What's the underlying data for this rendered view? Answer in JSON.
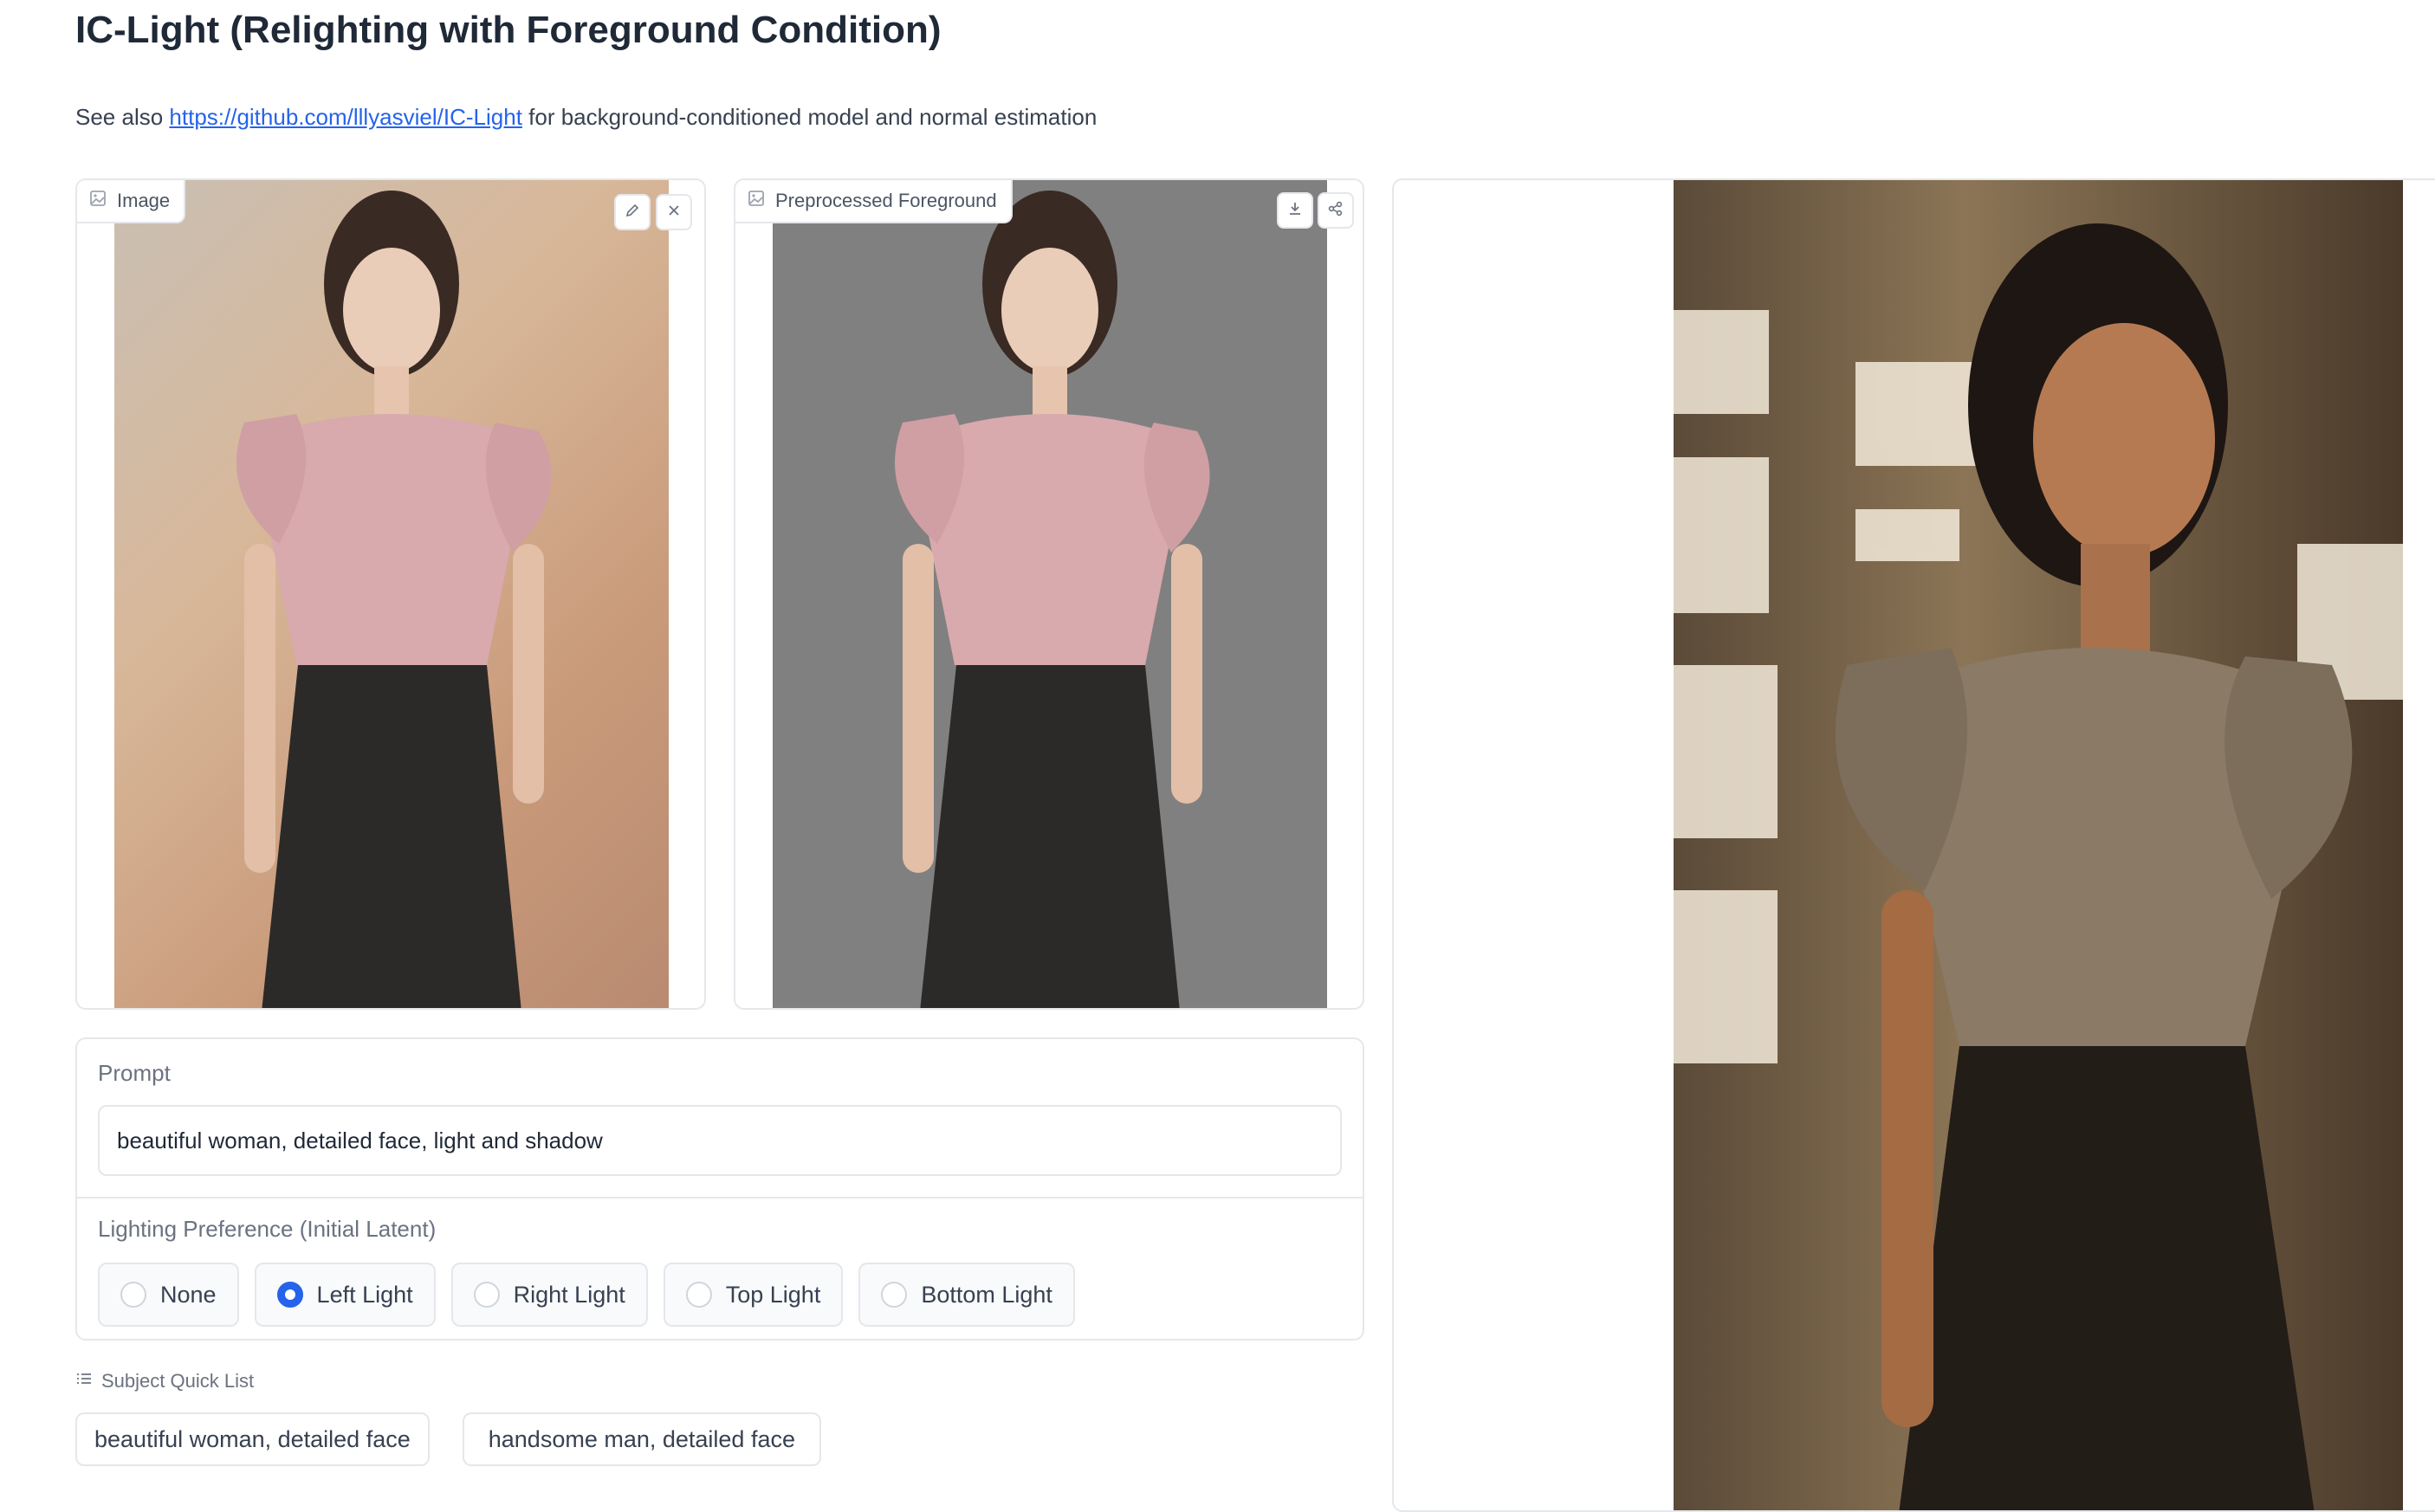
{
  "page": {
    "title": "IC-Light (Relighting with Foreground Condition)",
    "subtitle_prefix": "See also ",
    "subtitle_link": "https://github.com/lllyasviel/IC-Light",
    "subtitle_suffix": " for background-conditioned model and normal estimation"
  },
  "input_image": {
    "label": "Image",
    "icon": "image-icon",
    "tools": [
      "edit-icon",
      "close-icon"
    ]
  },
  "preprocessed": {
    "label": "Preprocessed Foreground",
    "icon": "image-icon",
    "tools": [
      "download-icon",
      "share-icon"
    ]
  },
  "prompt": {
    "label": "Prompt",
    "value": "beautiful woman, detailed face, light and shadow"
  },
  "lighting": {
    "label": "Lighting Preference (Initial Latent)",
    "options": [
      "None",
      "Left Light",
      "Right Light",
      "Top Light",
      "Bottom Light"
    ],
    "selected": "Left Light"
  },
  "subject_quick_list": {
    "label": "Subject Quick List",
    "items": [
      "beautiful woman, detailed face",
      "handsome man, detailed face"
    ]
  },
  "colors": {
    "accent": "#2563eb",
    "border": "#e5e7eb",
    "link": "#2563eb"
  }
}
